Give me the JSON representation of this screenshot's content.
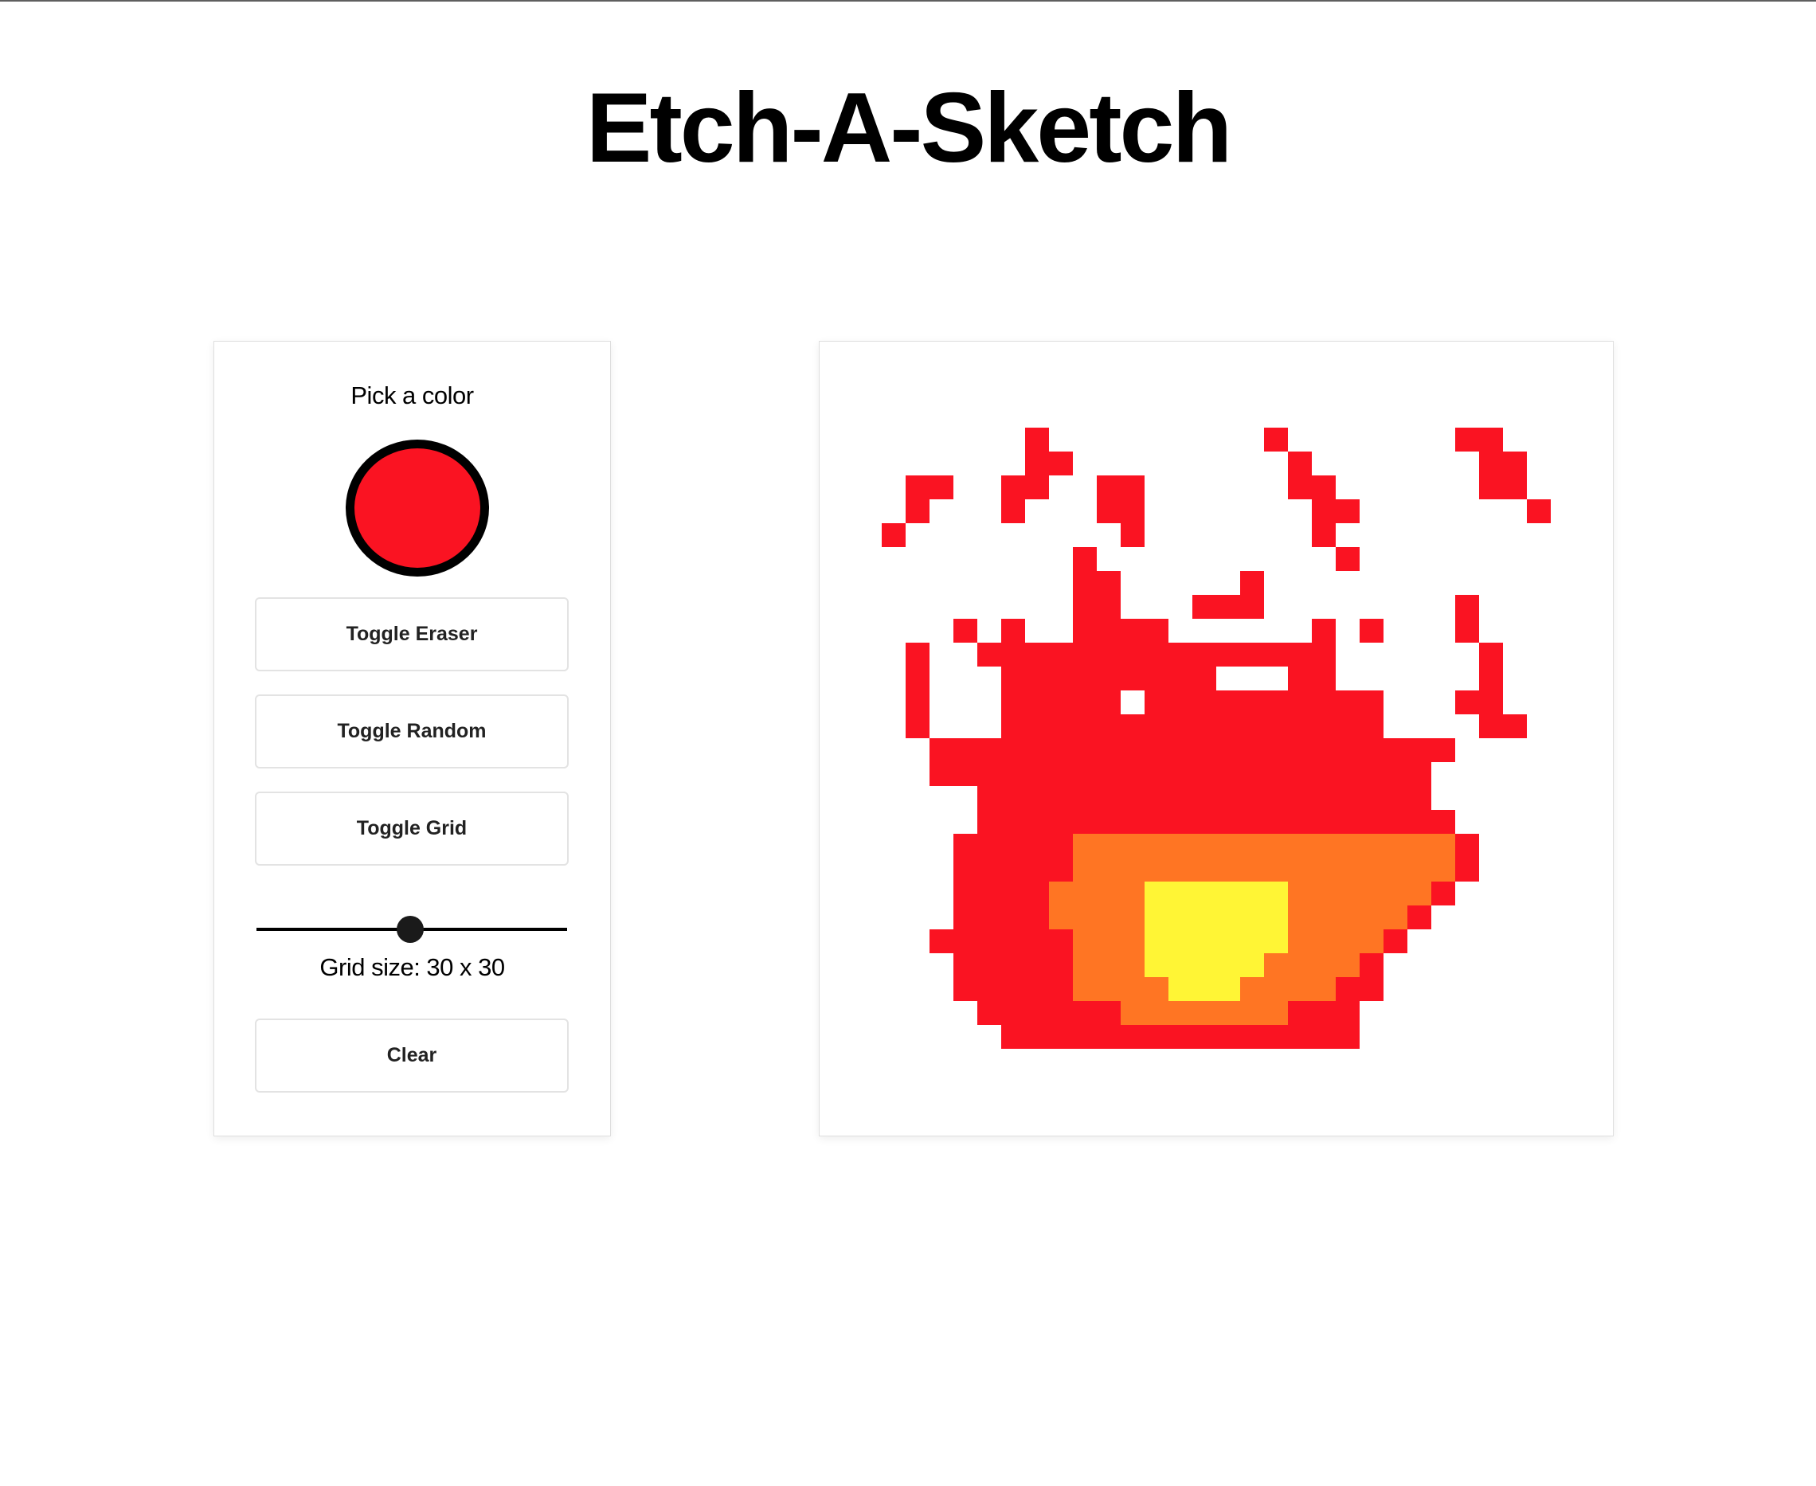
{
  "title": "Etch-A-Sketch",
  "controls": {
    "pick_label": "Pick a color",
    "selected_color": "#fa1322",
    "eraser_label": "Toggle Eraser",
    "random_label": "Toggle Random",
    "grid_label": "Toggle Grid",
    "grid_size_value": 30,
    "grid_size_label": "Grid size: 30 x 30",
    "clear_label": "Clear"
  },
  "palette": {
    ".": "#ffffff",
    "R": "#fa1322",
    "O": "#ff7523",
    "Y": "#fff535"
  },
  "drawing": [
    "..............................",
    "..............................",
    ".......R.........R.......RR...",
    ".......RR.........R.......RR..",
    "..RR..RR..RR......RR......RR..",
    "..R...R...RR.......RR.......R.",
    ".R.........R.......R..........",
    ".........R..........R.........",
    ".........RR.....R.............",
    ".........RR...RRR........R....",
    "....R.R..RRRR......R.R...R....",
    "..R..RRRRRRRRRRRRRRR......R...",
    "..R...RRRRRRRRR...RR......R...",
    "..R...RRRRR.RRRRRRRRRR...RR...",
    "..R...RRRRRRRRRRRRRRRR....RR..",
    "...RRRRRRRRRRRRRRRRRRRRRR.....",
    "...RRRRRRRRRRRRRRRRRRRRR......",
    ".....RRRRRRRRRRRRRRRRRRR......",
    ".....RRRRRRRRRRRRRRRRRRRR.....",
    "....RRRRROOOOOOOOOOOOOOOOR....",
    "....RRRRROOOOOOOOOOOOOOOOR....",
    "....RRRROOOOYYYYYYOOOOOOR.....",
    "....RRRROOOOYYYYYYOOOOOR......",
    "...RRRRRROOOYYYYYYOOOOR.......",
    "....RRRRROOOYYYYYOOOOR........",
    "....RRRRROOOOYYYOOOORR........",
    ".....RRRRRROOOOOOORRR.........",
    "......RRRRRRRRRRRRRRR.........",
    "..............................",
    ".............................."
  ]
}
